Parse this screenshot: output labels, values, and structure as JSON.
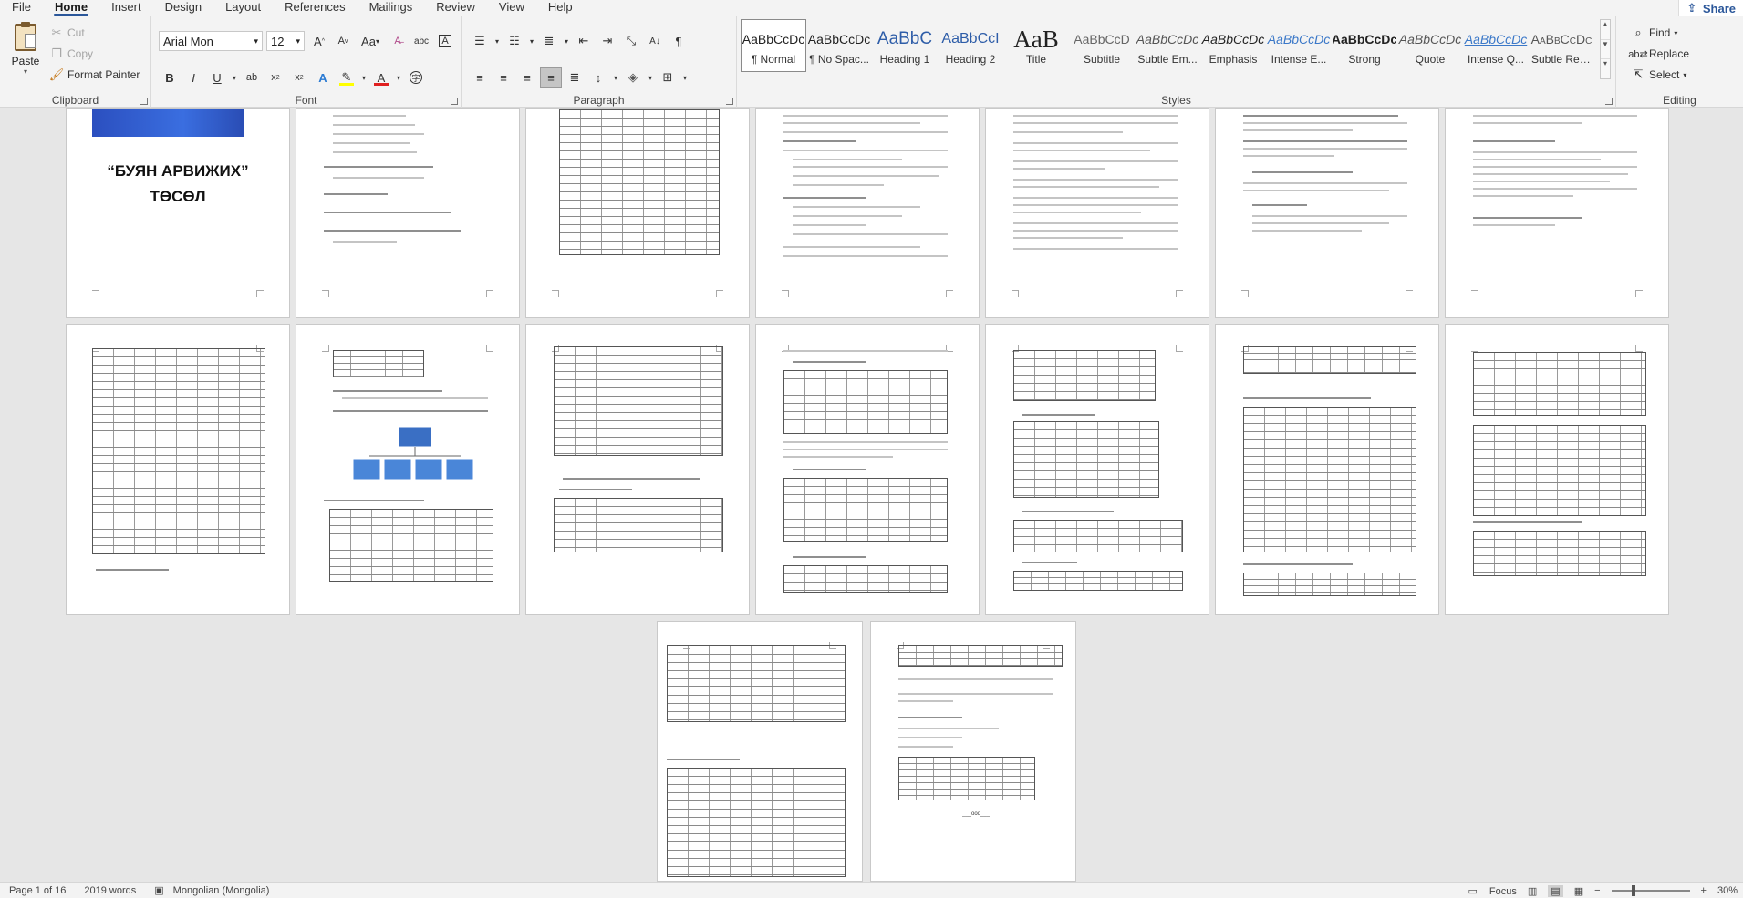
{
  "tabs": [
    "File",
    "Home",
    "Insert",
    "Design",
    "Layout",
    "References",
    "Mailings",
    "Review",
    "View",
    "Help"
  ],
  "active_tab": "Home",
  "share_label": "Share",
  "clipboard": {
    "paste": "Paste",
    "cut": "Cut",
    "copy": "Copy",
    "format_painter": "Format Painter",
    "label": "Clipboard"
  },
  "font": {
    "name": "Arial Mon",
    "size": "12",
    "label": "Font",
    "change_case": "Aa",
    "highlight_color": "#ffff00",
    "font_color": "#e02020"
  },
  "paragraph": {
    "label": "Paragraph"
  },
  "styles": {
    "label": "Styles",
    "items": [
      {
        "sample": "AaBbCcDc",
        "name": "¶ Normal",
        "selected": true
      },
      {
        "sample": "AaBbCcDc",
        "name": "¶ No Spac...",
        "selected": false
      },
      {
        "sample": "AaBbC",
        "name": "Heading 1",
        "selected": false
      },
      {
        "sample": "AaBbCcI",
        "name": "Heading 2",
        "selected": false
      },
      {
        "sample": "AaB",
        "name": "Title",
        "selected": false
      },
      {
        "sample": "AaBbCcD",
        "name": "Subtitle",
        "selected": false
      },
      {
        "sample": "AaBbCcDc",
        "name": "Subtle Em...",
        "selected": false
      },
      {
        "sample": "AaBbCcDc",
        "name": "Emphasis",
        "selected": false
      },
      {
        "sample": "AaBbCcDc",
        "name": "Intense E...",
        "selected": false
      },
      {
        "sample": "AaBbCcDc",
        "name": "Strong",
        "selected": false
      },
      {
        "sample": "AaBbCcDc",
        "name": "Quote",
        "selected": false
      },
      {
        "sample": "AaBbCcDc",
        "name": "Intense Q...",
        "selected": false
      },
      {
        "sample": "AaBbCcDc",
        "name": "Subtle Ref...",
        "selected": false
      }
    ]
  },
  "editing": {
    "label": "Editing",
    "find": "Find",
    "replace": "Replace",
    "select": "Select"
  },
  "document": {
    "cover_title_line1": "“БУЯН АРВИЖИХ”",
    "cover_title_line2": "ТӨСӨЛ",
    "page_footer_mark": "___ооо___"
  },
  "status": {
    "page": "Page 1 of 16",
    "words": "2019 words",
    "language": "Mongolian (Mongolia)",
    "focus": "Focus",
    "zoom": "30%"
  },
  "colors": {
    "accent": "#2b579a"
  }
}
